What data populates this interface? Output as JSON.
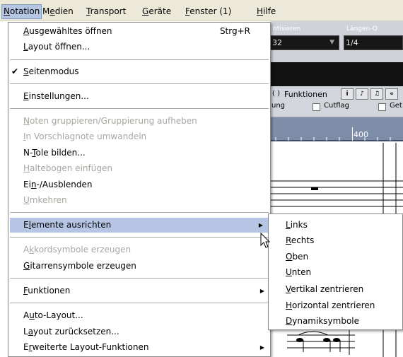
{
  "menubar": {
    "items": [
      {
        "label": "Notation",
        "key": "N"
      },
      {
        "label": "Medien",
        "key": "e"
      },
      {
        "label": "Transport",
        "key": "T"
      },
      {
        "label": "Geräte",
        "key": "G"
      },
      {
        "label": "Fenster (1)",
        "key": "F"
      },
      {
        "label": "Hilfe",
        "key": "H"
      }
    ]
  },
  "notation_menu": {
    "items": [
      {
        "label": "Ausgewähltes öffnen",
        "key": "A",
        "shortcut": "Strg+R"
      },
      {
        "label": "Layout öffnen...",
        "key": "L"
      },
      {
        "label": "Seitenmodus",
        "key": "S",
        "checked": true
      },
      {
        "label": "Einstellungen...",
        "key": "E"
      },
      {
        "label": "Noten gruppieren/Gruppierung aufheben",
        "key": "N",
        "disabled": true
      },
      {
        "label": "In Vorschlagnote umwandeln",
        "key": "I",
        "disabled": true
      },
      {
        "label": "N-Tole bilden...",
        "key": "T"
      },
      {
        "label": "Haltebogen einfügen",
        "key": "H",
        "disabled": true
      },
      {
        "label": "Ein-/Ausblenden",
        "key": "n"
      },
      {
        "label": "Umkehren",
        "key": "U",
        "disabled": true
      },
      {
        "label": "Elemente ausrichten",
        "key": "l",
        "submenu": true,
        "selected": true
      },
      {
        "label": "Akkordsymbole erzeugen",
        "key": "k",
        "disabled": true
      },
      {
        "label": "Gitarrensymbole erzeugen",
        "key": "G"
      },
      {
        "label": "Funktionen",
        "key": "F",
        "submenu": true
      },
      {
        "label": "Auto-Layout...",
        "key": "u"
      },
      {
        "label": "Layout zurücksetzen...",
        "key": "a"
      },
      {
        "label": "Erweiterte Layout-Funktionen",
        "key": "r",
        "submenu": true
      }
    ]
  },
  "submenu_align": {
    "items": [
      {
        "label": "Links",
        "key": "L"
      },
      {
        "label": "Rechts",
        "key": "R"
      },
      {
        "label": "Oben",
        "key": "O"
      },
      {
        "label": "Unten",
        "key": "U"
      },
      {
        "label": "Vertikal zentrieren",
        "key": "V"
      },
      {
        "label": "Horizontal zentrieren",
        "key": "H"
      },
      {
        "label": "Dynamiksymbole",
        "key": "D"
      }
    ]
  },
  "background": {
    "field1_label": "ntisieren",
    "field1_value": "32",
    "field2_label": "Längen-Q",
    "field2_value": "1/4",
    "functions_label": "Funktionen",
    "check1_label": "ung",
    "check2_label": "Cutflag",
    "check3_label": "Get",
    "ruler_value": "400"
  }
}
